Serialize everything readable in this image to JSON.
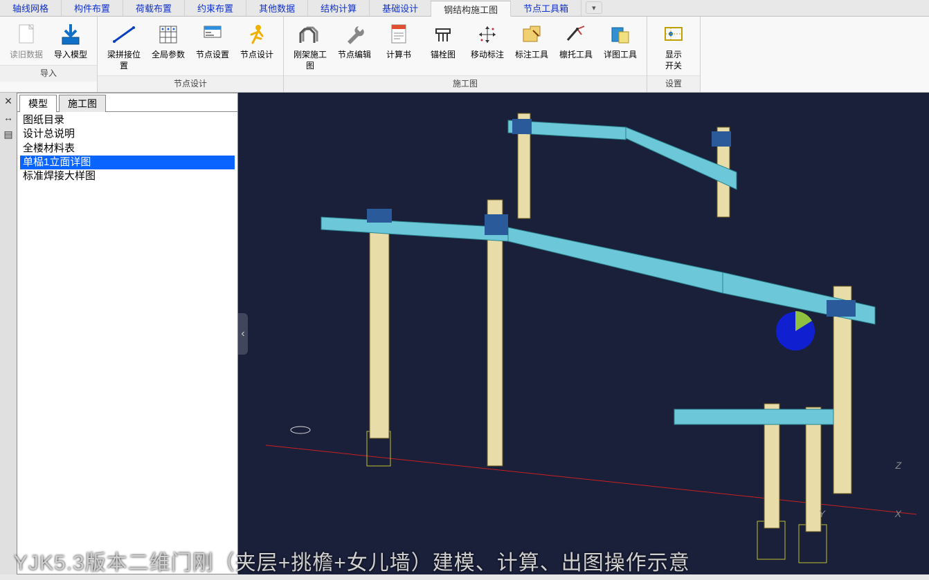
{
  "tabs": [
    {
      "label": "轴线网格",
      "active": false
    },
    {
      "label": "构件布置",
      "active": false
    },
    {
      "label": "荷载布置",
      "active": false
    },
    {
      "label": "约束布置",
      "active": false
    },
    {
      "label": "其他数据",
      "active": false
    },
    {
      "label": "结构计算",
      "active": false
    },
    {
      "label": "基础设计",
      "active": false
    },
    {
      "label": "钢结构施工图",
      "active": true
    },
    {
      "label": "节点工具箱",
      "active": false
    }
  ],
  "ribbon": {
    "groups": [
      {
        "label": "导入",
        "buttons": [
          {
            "label": "读旧数据",
            "icon": "page-icon",
            "disabled": true
          },
          {
            "label": "导入模型",
            "icon": "import-icon"
          }
        ]
      },
      {
        "label": "节点设计",
        "buttons": [
          {
            "label": "梁拼接位置",
            "icon": "beam-splice-icon"
          },
          {
            "label": "全局参数",
            "icon": "grid-icon"
          },
          {
            "label": "节点设置",
            "icon": "node-settings-icon"
          },
          {
            "label": "节点设计",
            "icon": "runner-icon"
          }
        ]
      },
      {
        "label": "施工图",
        "buttons": [
          {
            "label": "刚架施工图",
            "icon": "frame-draw-icon"
          },
          {
            "label": "节点编辑",
            "icon": "wrench-icon"
          },
          {
            "label": "计算书",
            "icon": "doc-icon"
          },
          {
            "label": "锚栓图",
            "icon": "anchor-icon"
          },
          {
            "label": "移动标注",
            "icon": "move-dim-icon"
          },
          {
            "label": "标注工具",
            "icon": "dim-tool-icon"
          },
          {
            "label": "檩托工具",
            "icon": "purlin-icon"
          },
          {
            "label": "详图工具",
            "icon": "detail-icon"
          }
        ]
      },
      {
        "label": "设置",
        "buttons": [
          {
            "label": "显示\n开关",
            "icon": "display-icon"
          }
        ]
      }
    ]
  },
  "side_panel": {
    "tabs": [
      {
        "label": "模型",
        "active": true
      },
      {
        "label": "施工图",
        "active": false
      }
    ],
    "tree": [
      {
        "label": "图纸目录",
        "selected": false
      },
      {
        "label": "设计总说明",
        "selected": false
      },
      {
        "label": "全楼材料表",
        "selected": false
      },
      {
        "label": "单榀1立面详图",
        "selected": true
      },
      {
        "label": "标准焊接大样图",
        "selected": false
      }
    ]
  },
  "axes": {
    "x": "X",
    "y": "Y",
    "z": "Z"
  },
  "caption": "YJK5.3版本二维门刚（夹层+挑檐+女儿墙）建模、计算、出图操作示意",
  "overflow_glyph": "▾"
}
